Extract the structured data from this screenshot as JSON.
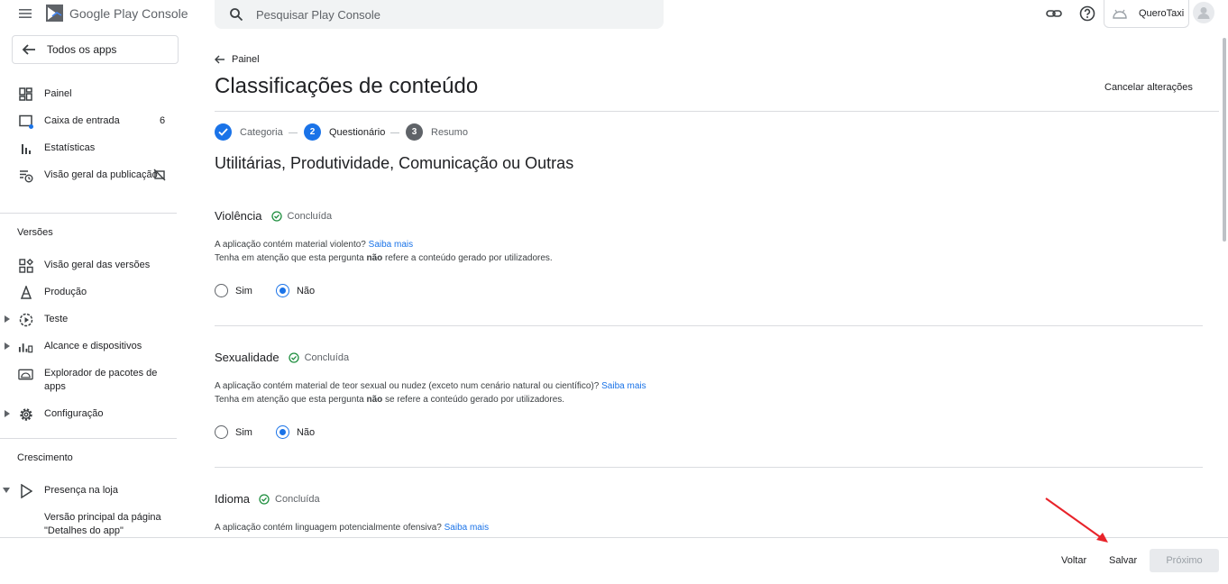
{
  "app": {
    "brand": "Google Play",
    "brand_suffix": "Console"
  },
  "search": {
    "placeholder": "Pesquisar Play Console"
  },
  "account": {
    "name": "QueroTaxi"
  },
  "sidebar": {
    "all_apps": "Todos os apps",
    "items": [
      {
        "label": "Painel",
        "icon": "dashboard-icon"
      },
      {
        "label": "Caixa de entrada",
        "icon": "inbox-icon",
        "badge": "6"
      },
      {
        "label": "Estatísticas",
        "icon": "bar-chart-icon"
      },
      {
        "label": "Visão geral da publicação",
        "icon": "publishing-icon"
      }
    ],
    "sections": [
      {
        "title": "Versões",
        "items": [
          {
            "label": "Visão geral das versões",
            "icon": "releases-overview-icon"
          },
          {
            "label": "Produção",
            "icon": "production-icon"
          },
          {
            "label": "Teste",
            "icon": "play-circle-icon"
          },
          {
            "label": "Alcance e dispositivos",
            "icon": "devices-chart-icon"
          },
          {
            "label": "Explorador de pacotes de apps",
            "icon": "bundle-explorer-icon"
          },
          {
            "label": "Configuração",
            "icon": "gear-icon"
          }
        ]
      },
      {
        "title": "Crescimento",
        "items": [
          {
            "label": "Presença na loja",
            "icon": "store-play-icon"
          },
          {
            "label": "Versão principal da página \"Detalhes do app\""
          }
        ]
      }
    ]
  },
  "main": {
    "back_label": "Painel",
    "title": "Classificações de conteúdo",
    "cancel_label": "Cancelar alterações",
    "steps": [
      {
        "num": "1",
        "label": "Categoria",
        "state": "done"
      },
      {
        "num": "2",
        "label": "Questionário",
        "state": "active"
      },
      {
        "num": "3",
        "label": "Resumo",
        "state": "pending"
      }
    ],
    "subtitle": "Utilitárias, Produtividade, Comunicação ou Outras",
    "questions": [
      {
        "title": "Violência",
        "status": "Concluída",
        "text": "A aplicação contém material violento?",
        "link": "Saiba mais",
        "note_pre": "Tenha em atenção que esta pergunta ",
        "note_bold": "não",
        "note_post": " refere a conteúdo gerado por utilizadores.",
        "opt_yes": "Sim",
        "opt_no": "Não",
        "selected": "Não"
      },
      {
        "title": "Sexualidade",
        "status": "Concluída",
        "text": "A aplicação contém material de teor sexual ou nudez (exceto num cenário natural ou científico)?",
        "link": "Saiba mais",
        "note_pre": "Tenha em atenção que esta pergunta ",
        "note_bold": "não",
        "note_post": " se refere a conteúdo gerado por utilizadores.",
        "opt_yes": "Sim",
        "opt_no": "Não",
        "selected": "Não"
      },
      {
        "title": "Idioma",
        "status": "Concluída",
        "text": "A aplicação contém linguagem potencialmente ofensiva?",
        "link": "Saiba mais"
      }
    ]
  },
  "footer": {
    "back": "Voltar",
    "save": "Salvar",
    "next": "Próximo"
  },
  "colors": {
    "accent": "#1a73e8",
    "success": "#1e8e3e",
    "annotation_arrow": "#e8232a"
  }
}
